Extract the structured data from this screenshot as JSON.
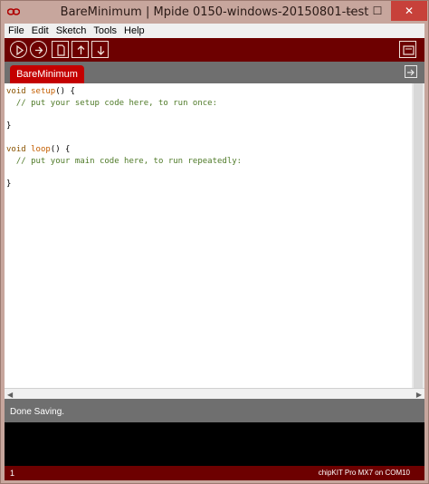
{
  "window": {
    "title": "BareMinimum | Mpide 0150-windows-20150801-test",
    "minimize_glyph": "—",
    "maximize_glyph": "☐",
    "close_glyph": "✕"
  },
  "menu": {
    "items": [
      {
        "label": "File"
      },
      {
        "label": "Edit"
      },
      {
        "label": "Sketch"
      },
      {
        "label": "Tools"
      },
      {
        "label": "Help"
      }
    ]
  },
  "toolbar": {
    "buttons": [
      {
        "name": "verify-button",
        "icon": "play-icon"
      },
      {
        "name": "upload-button",
        "icon": "upload-arrow-icon"
      },
      {
        "name": "new-button",
        "icon": "new-document-icon"
      },
      {
        "name": "open-button",
        "icon": "open-arrow-up-icon"
      },
      {
        "name": "save-button",
        "icon": "save-arrow-down-icon"
      },
      {
        "name": "serial-monitor-button",
        "icon": "monitor-icon"
      }
    ]
  },
  "tabs": [
    {
      "label": "BareMinimum",
      "active": true
    }
  ],
  "editor": {
    "lines": [
      [
        {
          "t": "void",
          "c": "kw-type"
        },
        {
          "t": " "
        },
        {
          "t": "setup",
          "c": "kw-fn"
        },
        {
          "t": "() {"
        }
      ],
      [
        {
          "t": "  "
        },
        {
          "t": "// put your setup code here, to run once:",
          "c": "comment"
        }
      ],
      [
        {
          "t": ""
        }
      ],
      [
        {
          "t": "}"
        }
      ],
      [
        {
          "t": ""
        }
      ],
      [
        {
          "t": "void",
          "c": "kw-type"
        },
        {
          "t": " "
        },
        {
          "t": "loop",
          "c": "kw-fn"
        },
        {
          "t": "() {"
        }
      ],
      [
        {
          "t": "  "
        },
        {
          "t": "// put your main code here, to run repeatedly:",
          "c": "comment"
        }
      ],
      [
        {
          "t": ""
        }
      ],
      [
        {
          "t": "}"
        }
      ]
    ]
  },
  "status": {
    "message": "Done Saving."
  },
  "footer": {
    "line_number": "1",
    "board": "chipKIT Pro MX7",
    "on_label": "on",
    "port": "COM10"
  },
  "colors": {
    "toolbar_bg": "#6d0000",
    "tab_active": "#c40000",
    "keyword_type": "#8a5300",
    "keyword_fn": "#c45e00",
    "comment": "#4f7a28"
  }
}
